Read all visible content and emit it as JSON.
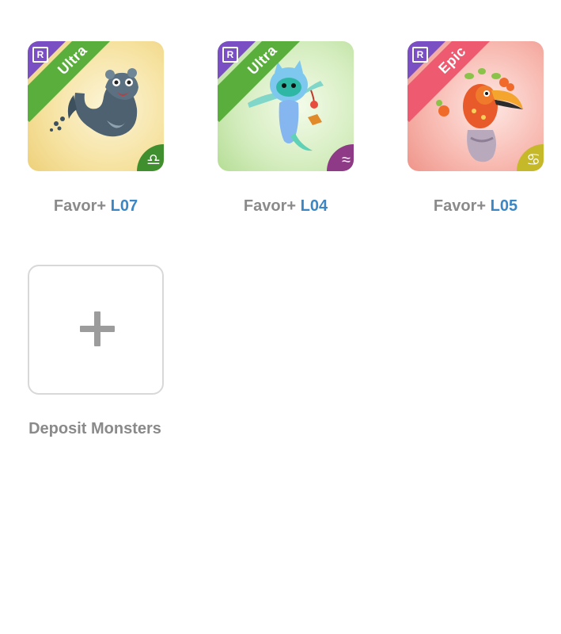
{
  "monsters": [
    {
      "rarity": "Ultra",
      "registry_badge": "R",
      "label_prefix": "Favor+",
      "level": "L07",
      "zodiac_icon": "libra-icon",
      "zodiac_glyph": "♎",
      "colors": {
        "bg_light": "#fbf1c9",
        "bg_dark": "#f0d37e",
        "ribbon": "#5aaf3c",
        "sign_bg": "#3f8f2e"
      }
    },
    {
      "rarity": "Ultra",
      "registry_badge": "R",
      "label_prefix": "Favor+",
      "level": "L04",
      "zodiac_icon": "aquarius-icon",
      "zodiac_glyph": "≈",
      "colors": {
        "bg_light": "#eef8e2",
        "bg_dark": "#b8de98",
        "ribbon": "#5aaf3c",
        "sign_bg": "#8e3a86"
      }
    },
    {
      "rarity": "Epic",
      "registry_badge": "R",
      "label_prefix": "Favor+",
      "level": "L05",
      "zodiac_icon": "cancer-icon",
      "zodiac_glyph": "♋",
      "colors": {
        "bg_light": "#fde0dc",
        "bg_dark": "#f29a92",
        "ribbon": "#ee5a70",
        "sign_bg": "#c5b92a"
      }
    }
  ],
  "deposit": {
    "label": "Deposit Monsters",
    "icon": "plus-icon"
  }
}
